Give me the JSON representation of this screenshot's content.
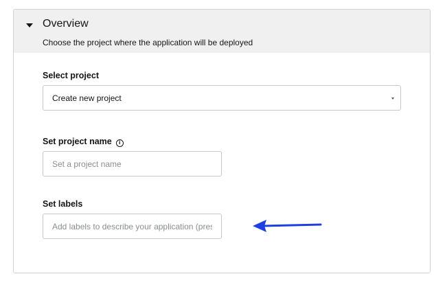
{
  "overview": {
    "title": "Overview",
    "description": "Choose the project where the application will be deployed"
  },
  "select_project": {
    "label": "Select project",
    "selected_value": "Create new project"
  },
  "project_name": {
    "label": "Set project name",
    "value": "",
    "placeholder": "Set a project name"
  },
  "labels": {
    "label": "Set labels",
    "value": "",
    "placeholder": "Add labels to describe your application (press enter to add)"
  },
  "icons": {
    "toggle": "caret-down-icon",
    "info": "info-icon",
    "select": "chevron-down-icon",
    "annotation": "arrow-left-icon"
  },
  "colors": {
    "annotation_arrow": "#1f3ee0",
    "header_background": "#f0f0f0"
  }
}
